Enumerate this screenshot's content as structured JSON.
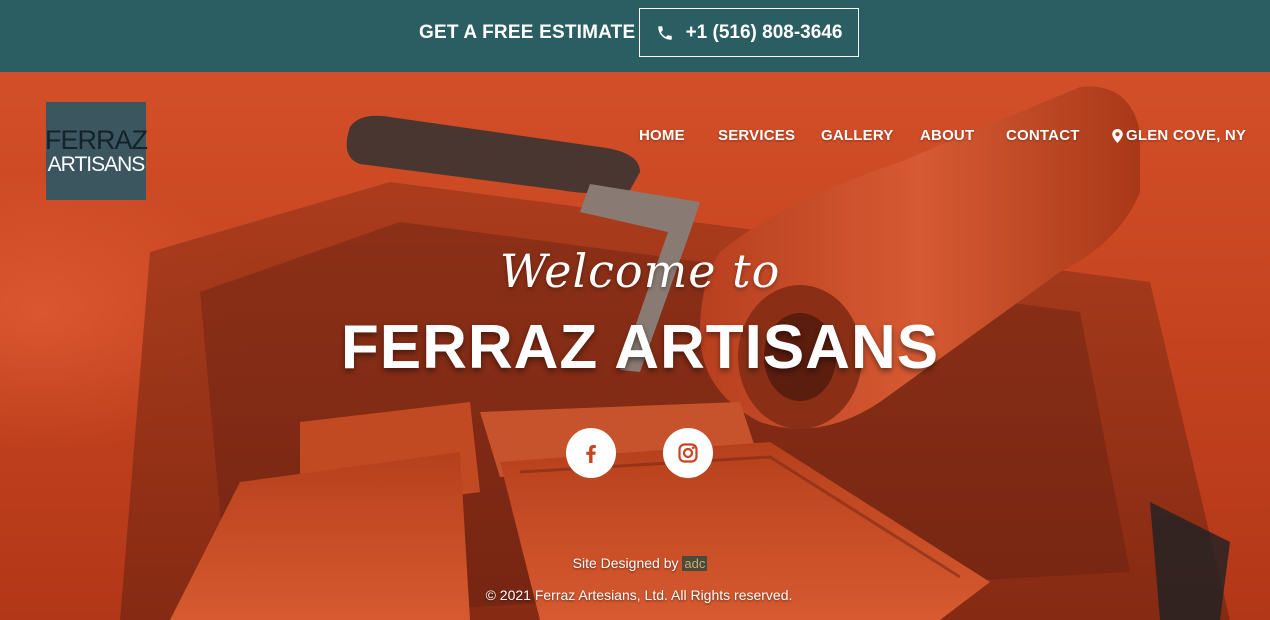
{
  "topbar": {
    "estimate_label": "GET A FREE ESTIMATE",
    "phone_label": "+1 (516) 808-3646",
    "phone_icon": "phone-icon",
    "background_color": "#2b5e63"
  },
  "logo": {
    "line1": "FERRAZ",
    "line2": "ARTISANS",
    "background_color": "#3c5660"
  },
  "nav": {
    "items": [
      {
        "label": "HOME"
      },
      {
        "label": "SERVICES"
      },
      {
        "label": "GALLERY"
      },
      {
        "label": "ABOUT"
      },
      {
        "label": "CONTACT"
      }
    ],
    "location_label": "GLEN COVE, NY",
    "location_icon": "map-pin-icon"
  },
  "hero": {
    "welcome": "Welcome to",
    "title": "FERRAZ ARTISANS",
    "accent_color": "#c6441f"
  },
  "social": {
    "facebook_icon": "facebook-icon",
    "instagram_icon": "instagram-icon"
  },
  "footer": {
    "designed_by_prefix": "Site Designed by",
    "designer": "adc",
    "copyright": "© 2021 Ferraz Artesians, Ltd. All Rights reserved."
  }
}
